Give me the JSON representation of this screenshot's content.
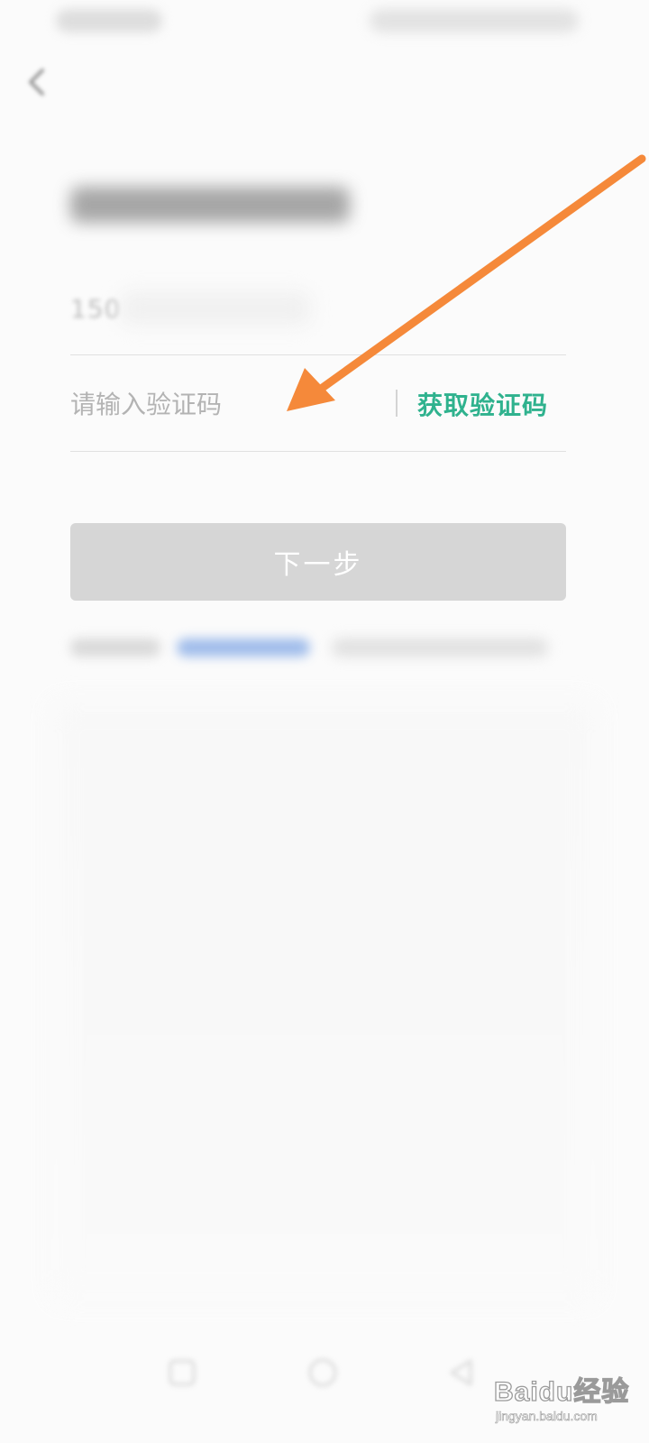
{
  "form": {
    "phone_prefix": "150",
    "code_placeholder": "请输入验证码",
    "get_code_label": "获取验证码",
    "next_label": "下一步"
  },
  "watermark": {
    "text": "Baidu经验",
    "url": "jingyan.baidu.com"
  },
  "colors": {
    "accent_green": "#2fb28e",
    "annotation_arrow": "#f5893a",
    "disabled_button": "#d6d6d6"
  },
  "icons": {
    "back": "chevron-left-icon",
    "nav_recent": "square-icon",
    "nav_home": "circle-icon",
    "nav_back": "triangle-icon"
  }
}
